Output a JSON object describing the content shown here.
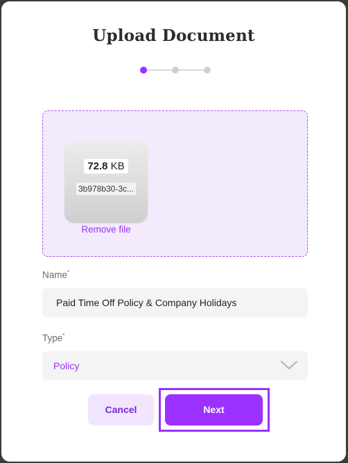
{
  "dialog": {
    "title": "Upload Document",
    "stepper": {
      "total_steps": 3,
      "current_step": 1
    }
  },
  "upload": {
    "file_size_value": "72.8",
    "file_size_unit": "KB",
    "file_name": "3b978b30-3c...",
    "remove_label": "Remove file"
  },
  "form": {
    "name_label": "Name",
    "name_value": "Paid Time Off Policy & Company Holidays",
    "type_label": "Type",
    "type_value": "Policy",
    "required_marker": "*"
  },
  "actions": {
    "cancel_label": "Cancel",
    "next_label": "Next"
  },
  "colors": {
    "accent": "#9b30ff",
    "dropzone_bg": "#f3eafc",
    "cancel_bg": "#f1e6fd",
    "field_bg": "#f4f4f4"
  },
  "icons": {
    "type_select": "chevron-down-icon"
  }
}
